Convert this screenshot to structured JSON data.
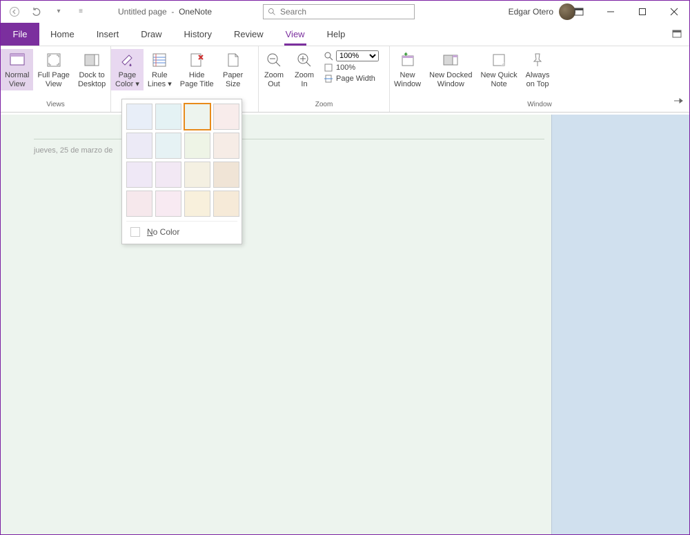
{
  "titlebar": {
    "doc": "Untitled page",
    "sep": "-",
    "app": "OneNote",
    "search_placeholder": "Search",
    "user": "Edgar Otero"
  },
  "tabs": {
    "file": "File",
    "items": [
      "Home",
      "Insert",
      "Draw",
      "History",
      "Review",
      "View",
      "Help"
    ],
    "active": "View"
  },
  "ribbon": {
    "views": {
      "label": "Views",
      "normal": "Normal\nView",
      "fullpage": "Full Page\nView",
      "dock": "Dock to\nDesktop"
    },
    "pagesetup": {
      "pagecolor": "Page\nColor",
      "rule": "Rule\nLines",
      "hide": "Hide\nPage Title",
      "paper": "Paper\nSize"
    },
    "zoom": {
      "label": "Zoom",
      "out": "Zoom\nOut",
      "in": "Zoom\nIn",
      "value": "100%",
      "hundred": "100%",
      "pagewidth": "Page Width"
    },
    "window": {
      "label": "Window",
      "neww": "New\nWindow",
      "docked": "New Docked\nWindow",
      "quick": "New Quick\nNote",
      "ontop": "Always\non Top"
    },
    "picker": {
      "nocolor_prefix": "N",
      "nocolor_rest": "o Color",
      "colors": [
        "#e8eef8",
        "#e4f2f4",
        "#edf4ee",
        "#f8eceb",
        "#eceaf6",
        "#e6f2f4",
        "#eef4e6",
        "#f6ece6",
        "#efe8f6",
        "#f2e8f4",
        "#f4f0e2",
        "#f0e4d6",
        "#f6e8ec",
        "#f8eaf2",
        "#f8f0dc",
        "#f6ead8"
      ],
      "selected_index": 2
    }
  },
  "canvas": {
    "date": "jueves, 25 de marzo de"
  }
}
